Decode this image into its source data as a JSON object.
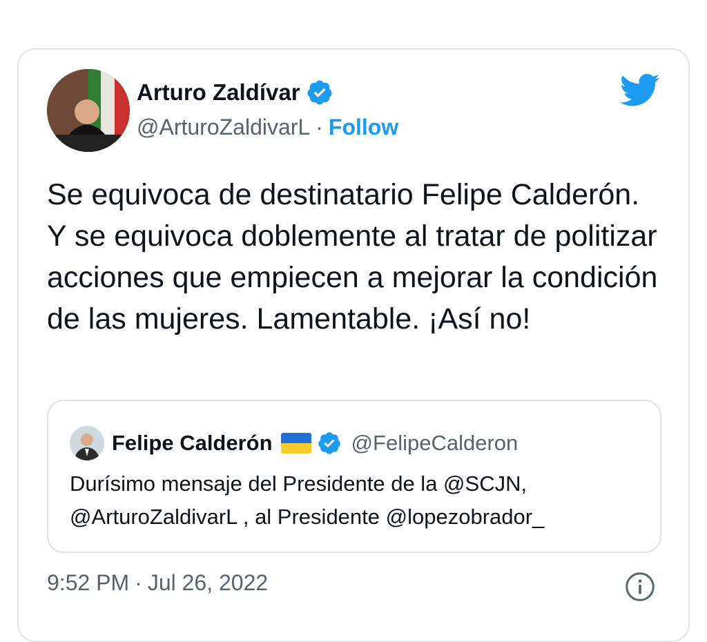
{
  "tweet": {
    "author_name": "Arturo Zaldívar",
    "author_handle": "@ArturoZaldivarL",
    "separator": "·",
    "follow_label": "Follow",
    "text": "Se equivoca de destinatario Felipe Calderón. Y se equivoca doblemente al tratar de politizar acciones que empiecen a mejorar la condición de las mujeres. Lamentable. ¡Así no!",
    "time": "9:52 PM",
    "date": "Jul 26, 2022"
  },
  "quoted": {
    "author_name": "Felipe Calderón",
    "author_handle": "@FelipeCalderon",
    "text_line1": "Durísimo mensaje del Presidente de la @SCJN,",
    "text_line2": "@ArturoZaldivarL , al Presidente @lopezobrador_"
  },
  "icons": {
    "verified": "verified-badge-icon",
    "brand": "twitter-bird-icon",
    "info": "info-icon",
    "flag": "ukraine-flag-icon"
  },
  "colors": {
    "accent": "#1d9bf0",
    "text": "#0f1419",
    "secondary": "#536471",
    "border": "#dfe4e8"
  }
}
